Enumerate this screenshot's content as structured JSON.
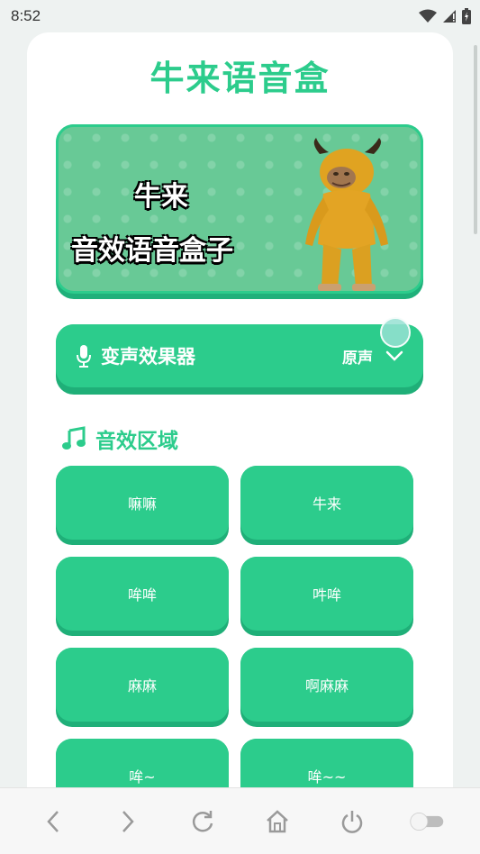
{
  "status_bar": {
    "time": "8:52"
  },
  "app": {
    "title": "牛来语音盒"
  },
  "banner": {
    "line1": "牛来",
    "line2": "音效语音盒子"
  },
  "voice_changer": {
    "label": "变声效果器",
    "value": "原声"
  },
  "sound_section": {
    "title": "音效区域",
    "items": [
      {
        "label": "嘛嘛"
      },
      {
        "label": "牛来"
      },
      {
        "label": "哞哞"
      },
      {
        "label": "吽哞"
      },
      {
        "label": "麻麻"
      },
      {
        "label": "啊麻麻"
      },
      {
        "label": "哞~"
      },
      {
        "label": "哞~~"
      }
    ]
  },
  "colors": {
    "accent": "#2ccc8c",
    "accent_dark": "#1faf78",
    "banner_bg": "#68c996"
  }
}
